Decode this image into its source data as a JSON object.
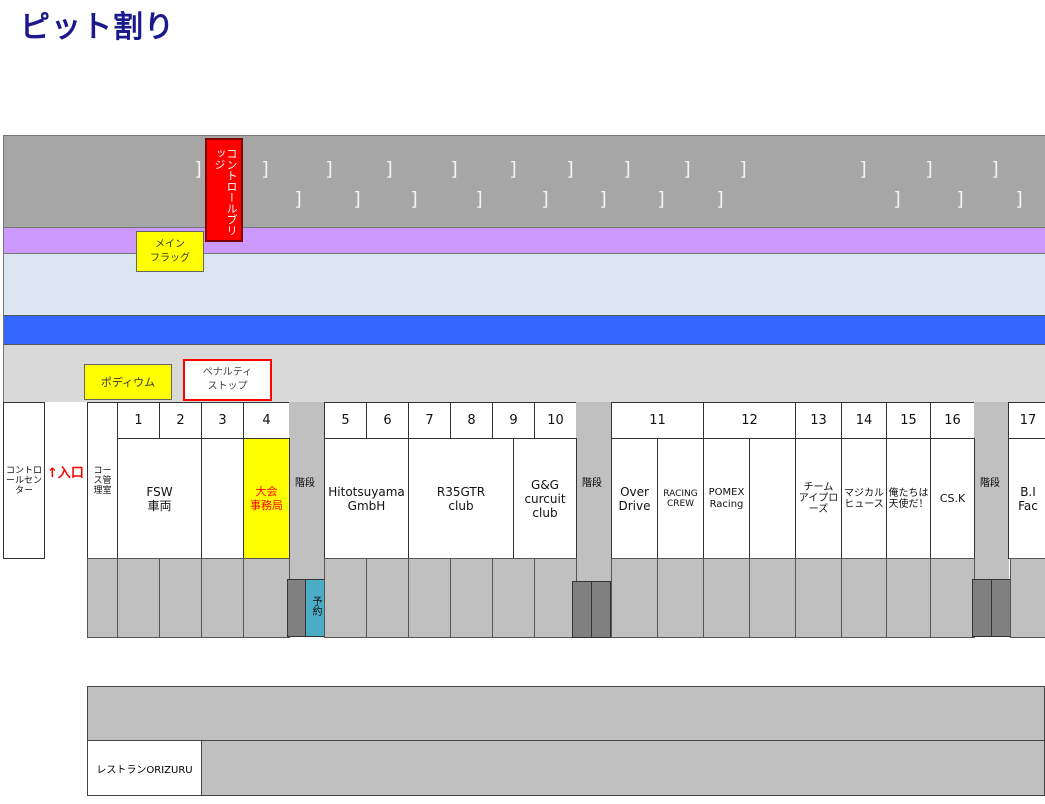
{
  "page": {
    "title": "ピット割り"
  },
  "facilities": {
    "control_bridge": "コントロールブリッジ",
    "main_flag": [
      "メイン",
      "フラッグ"
    ],
    "podium": "ポディウム",
    "penalty_stop": [
      "ペナルティ",
      "ストップ"
    ],
    "control_center": "コントロールセンター",
    "entrance": "↑入口",
    "course_management": "コース管理室",
    "restaurant": "レストランORIZURU",
    "stairs_label": "階段",
    "reserved": "予約"
  },
  "pit_numbers": [
    "1",
    "2",
    "3",
    "4",
    "5",
    "6",
    "7",
    "8",
    "9",
    "10",
    "11",
    "12",
    "13",
    "14",
    "15",
    "16",
    "17"
  ],
  "teams": {
    "fsw": [
      "FSW",
      "車両"
    ],
    "taikai": [
      "大会",
      "事務局"
    ],
    "hitotsuyama": [
      "Hitotsuyama",
      "GmbH"
    ],
    "r35gtr": [
      "R35GTR",
      "club"
    ],
    "gg": [
      "G&G",
      "curcuit",
      "club"
    ],
    "overdrive": [
      "Over",
      "Drive"
    ],
    "racing_crew": [
      "RACING",
      "CREW"
    ],
    "pomex": [
      "POMEX",
      "Racing"
    ],
    "team_approach": [
      "チーム",
      "アイプロ",
      "ーズ"
    ],
    "magical": [
      "マジカル",
      "ヒュース"
    ],
    "oretachi": [
      "俺たちは",
      "天使だ！"
    ],
    "csk": "CS.K",
    "bi": [
      "B.I",
      "Fac"
    ]
  },
  "colors": {
    "title": "#1a1a8c",
    "track_gray": "#a6a6a6",
    "purple_band": "#cc99ff",
    "blue_band": "#3366ff",
    "highlight_yellow": "#ffff00",
    "control_red": "#ff0000",
    "reserved_blue": "#4bacc6"
  }
}
